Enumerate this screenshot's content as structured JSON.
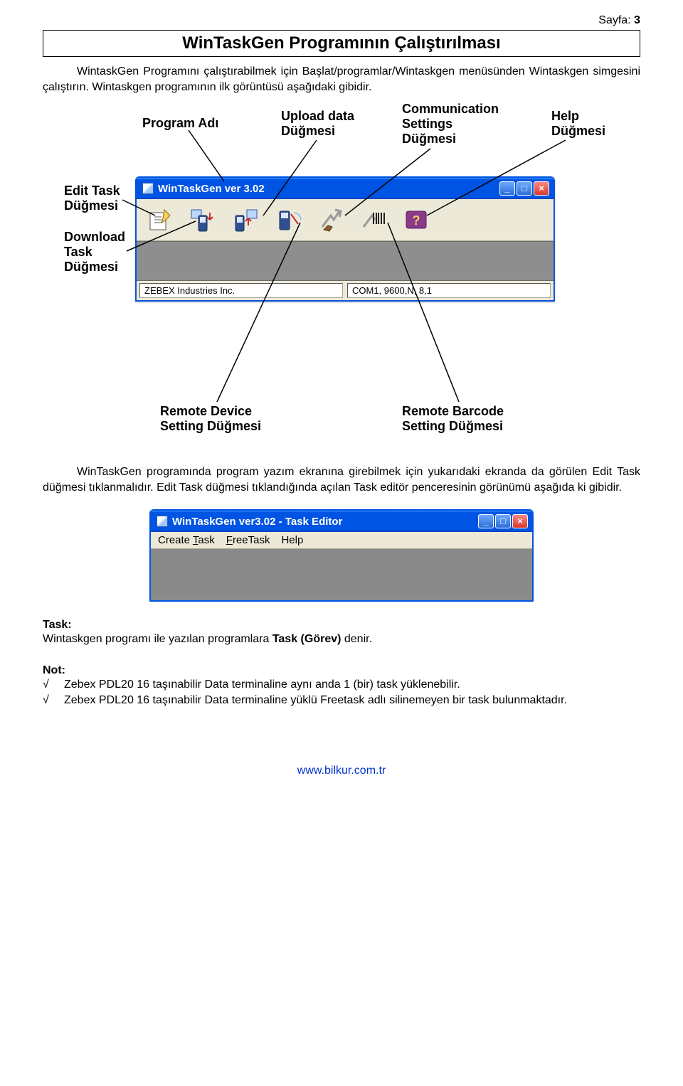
{
  "page": {
    "header_label": "Sayfa:",
    "header_page": "3",
    "title": "WinTaskGen Programının Çalıştırılması",
    "paragraph1": "WintaskGen Programını çalıştırabilmek için Başlat/programlar/Wintaskgen menüsünden Wintaskgen simgesini çalıştırın. Wintaskgen programının ilk görüntüsü aşağıdaki gibidir.",
    "paragraph2": "WinTaskGen programında program yazım ekranına girebilmek için yukarıdaki ekranda da görülen Edit Task düğmesi tıklanmalıdır. Edit Task düğmesi tıklandığında açılan Task editör penceresinin görünümü aşağıda ki gibidir."
  },
  "diagram": {
    "labels": {
      "program_adi": "Program Adı",
      "upload_data": "Upload data\nDüğmesi",
      "comm": "Communication\nSettings\nDüğmesi",
      "help": "Help\nDüğmesi",
      "edit_task": "Edit Task\nDüğmesi",
      "download_task": "Download\nTask\nDüğmesi",
      "remote_device": "Remote Device\nSetting Düğmesi",
      "remote_barcode": "Remote Barcode\nSetting Düğmesi"
    },
    "window": {
      "title": "WinTaskGen ver 3.02",
      "status_left": "ZEBEX Industries Inc.",
      "status_right": "COM1, 9600,N, 8,1",
      "tools": [
        "edit-task",
        "download-task",
        "upload-data",
        "remote-device",
        "comm-settings",
        "remote-barcode",
        "help"
      ]
    }
  },
  "diagram2": {
    "title": "WinTaskGen ver3.02 - Task Editor",
    "menu": {
      "create_task": "Create Task",
      "free_task": "FreeTask",
      "help": "Help"
    }
  },
  "task_section": {
    "title": "Task:",
    "line1_a": "Wintaskgen programı ile yazılan programlara ",
    "line1_bold": "Task (Görev)",
    "line1_b": " denir.",
    "not_title": "Not:",
    "item1": "Zebex PDL20 16 taşınabilir Data terminaline aynı anda 1 (bir) task yüklenebilir.",
    "item2": "Zebex PDL20 16 taşınabilir Data terminaline yüklü Freetask adlı silinemeyen bir task bulunmaktadır."
  },
  "footer": {
    "link": "www.bilkur.com.tr"
  }
}
